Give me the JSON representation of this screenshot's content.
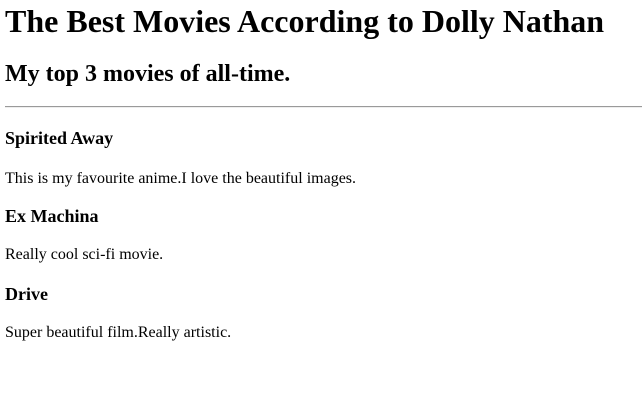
{
  "page": {
    "title": "The Best Movies According to Dolly Nathan",
    "subtitle": "My top 3 movies of all-time."
  },
  "movies": [
    {
      "title": "Spirited Away",
      "description": "This is my favourite anime.I love the beautiful images."
    },
    {
      "title": "Ex Machina",
      "description": "Really cool sci-fi movie."
    },
    {
      "title": "Drive",
      "description": "Super beautiful film.Really artistic."
    }
  ]
}
